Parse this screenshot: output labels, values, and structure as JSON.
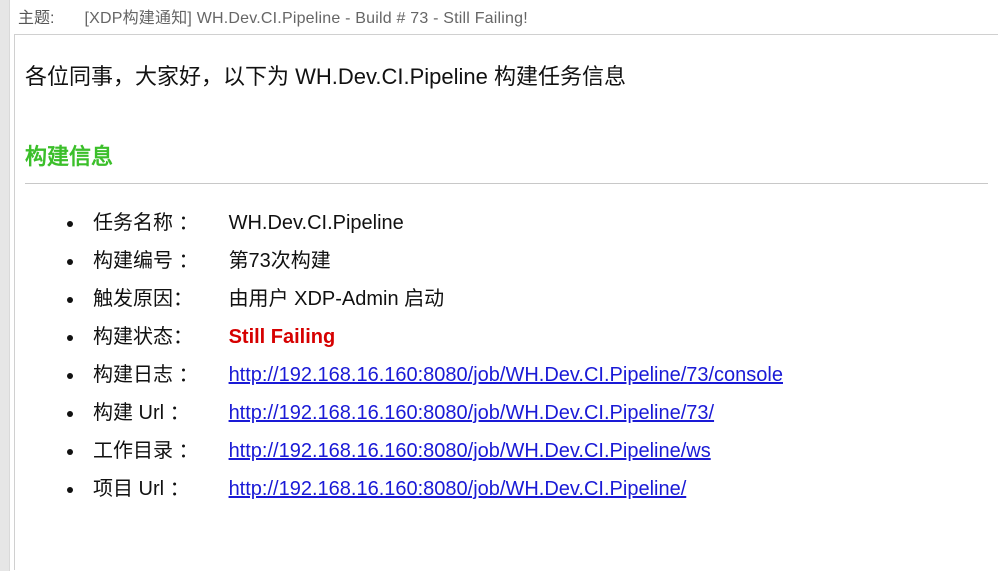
{
  "subject": {
    "label": "主题:",
    "text": "[XDP构建通知] WH.Dev.CI.Pipeline - Build # 73 - Still Failing!"
  },
  "greeting": "各位同事，大家好，以下为 WH.Dev.CI.Pipeline 构建任务信息",
  "section_header": "构建信息",
  "items": {
    "task_name": {
      "label": "任务名称 ：",
      "value": " WH.Dev.CI.Pipeline"
    },
    "build_no": {
      "label": "构建编号 ：",
      "value": " 第73次构建"
    },
    "cause": {
      "label": "触发原因：",
      "value": " 由用户 XDP-Admin 启动"
    },
    "status": {
      "label": "构建状态：",
      "value": " Still Failing"
    },
    "log": {
      "label": "构建日志 ：",
      "url": "http://192.168.16.160:8080/job/WH.Dev.CI.Pipeline/73/console"
    },
    "build_url": {
      "label": "构建 Url ：",
      "url": "http://192.168.16.160:8080/job/WH.Dev.CI.Pipeline/73/"
    },
    "workspace": {
      "label": "工作目录 ：",
      "url": " http://192.168.16.160:8080/job/WH.Dev.CI.Pipeline/ws"
    },
    "project_url": {
      "label": "项目 Url ：",
      "url": "http://192.168.16.160:8080/job/WH.Dev.CI.Pipeline/"
    }
  }
}
